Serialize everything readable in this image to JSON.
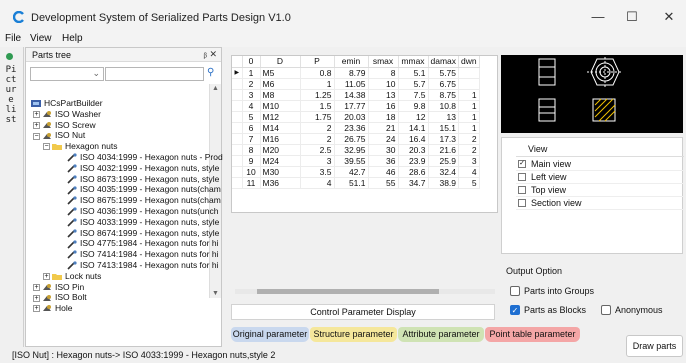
{
  "window": {
    "title": "Development System of Serialized Parts Design V1.0",
    "minimize": "—",
    "maximize": "☐",
    "close": "✕"
  },
  "menu": [
    "File",
    "View",
    "Help"
  ],
  "side_tab": {
    "label": "Picture list"
  },
  "tree_panel": {
    "title": "Parts tree",
    "header_buttons": "ᵦ ✕",
    "search_value": "",
    "items": [
      {
        "text": "HCsPartBuilder",
        "level": 0,
        "expander": "",
        "icon": "root"
      },
      {
        "text": "ISO Washer",
        "level": 1,
        "expander": "+",
        "icon": "part"
      },
      {
        "text": "ISO Screw",
        "level": 1,
        "expander": "+",
        "icon": "part"
      },
      {
        "text": "ISO Nut",
        "level": 1,
        "expander": "−",
        "icon": "part"
      },
      {
        "text": "Hexagon nuts",
        "level": 2,
        "expander": "−",
        "icon": "folder"
      },
      {
        "text": "ISO 4034:1999 - Hexagon nuts - Prod",
        "level": 3,
        "expander": "",
        "icon": "tool"
      },
      {
        "text": "ISO 4032:1999 - Hexagon nuts, style",
        "level": 3,
        "expander": "",
        "icon": "tool"
      },
      {
        "text": "ISO 8673:1999 - Hexagon nuts, style",
        "level": 3,
        "expander": "",
        "icon": "tool"
      },
      {
        "text": "ISO 4035:1999 - Hexagon nuts(cham",
        "level": 3,
        "expander": "",
        "icon": "tool"
      },
      {
        "text": "ISO 8675:1999 - Hexagon nuts(cham",
        "level": 3,
        "expander": "",
        "icon": "tool"
      },
      {
        "text": "ISO 4036:1999 - Hexagon nuts(unch",
        "level": 3,
        "expander": "",
        "icon": "tool"
      },
      {
        "text": "ISO 4033:1999 - Hexagon nuts, style",
        "level": 3,
        "expander": "",
        "icon": "tool"
      },
      {
        "text": "ISO 8674:1999 - Hexagon nuts, style",
        "level": 3,
        "expander": "",
        "icon": "tool"
      },
      {
        "text": "ISO 4775:1984 - Hexagon nuts for hi",
        "level": 3,
        "expander": "",
        "icon": "tool"
      },
      {
        "text": "ISO 7414:1984 - Hexagon nuts for hi",
        "level": 3,
        "expander": "",
        "icon": "tool"
      },
      {
        "text": "ISO 7413:1984 - Hexagon nuts for hi",
        "level": 3,
        "expander": "",
        "icon": "tool"
      },
      {
        "text": "Lock nuts",
        "level": 2,
        "expander": "+",
        "icon": "folder"
      },
      {
        "text": "ISO Pin",
        "level": 1,
        "expander": "+",
        "icon": "part"
      },
      {
        "text": "ISO Bolt",
        "level": 1,
        "expander": "+",
        "icon": "part"
      },
      {
        "text": "Hole",
        "level": 1,
        "expander": "+",
        "icon": "part"
      }
    ]
  },
  "grid": {
    "columns": [
      "",
      "0",
      "D",
      "P",
      "emin",
      "smax",
      "mmax",
      "damax",
      "dwn"
    ],
    "rows": [
      [
        "▶",
        "1",
        "M5",
        "0.8",
        "8.79",
        "8",
        "5.1",
        "5.75",
        ""
      ],
      [
        "",
        "2",
        "M6",
        "1",
        "11.05",
        "10",
        "5.7",
        "6.75",
        ""
      ],
      [
        "",
        "3",
        "M8",
        "1.25",
        "14.38",
        "13",
        "7.5",
        "8.75",
        "1"
      ],
      [
        "",
        "4",
        "M10",
        "1.5",
        "17.77",
        "16",
        "9.8",
        "10.8",
        "1"
      ],
      [
        "",
        "5",
        "M12",
        "1.75",
        "20.03",
        "18",
        "12",
        "13",
        "1"
      ],
      [
        "",
        "6",
        "M14",
        "2",
        "23.36",
        "21",
        "14.1",
        "15.1",
        "1"
      ],
      [
        "",
        "7",
        "M16",
        "2",
        "26.75",
        "24",
        "16.4",
        "17.3",
        "2"
      ],
      [
        "",
        "8",
        "M20",
        "2.5",
        "32.95",
        "30",
        "20.3",
        "21.6",
        "2"
      ],
      [
        "",
        "9",
        "M24",
        "3",
        "39.55",
        "36",
        "23.9",
        "25.9",
        "3"
      ],
      [
        "",
        "10",
        "M30",
        "3.5",
        "42.7",
        "46",
        "28.6",
        "32.4",
        "4"
      ],
      [
        "",
        "11",
        "M36",
        "4",
        "51.1",
        "55",
        "34.7",
        "38.9",
        "5"
      ]
    ]
  },
  "control_button": "Control Parameter Display",
  "tabs": [
    {
      "label": "Original parameter",
      "color": "#c9d8ee"
    },
    {
      "label": "Structure parameter",
      "color": "#f5e79b"
    },
    {
      "label": "Attribute parameter",
      "color": "#cfe3b4"
    },
    {
      "label": "Point table parameter",
      "color": "#f4a6a6"
    }
  ],
  "view_panel": {
    "header": "View",
    "items": [
      {
        "label": "Main view",
        "checked": true
      },
      {
        "label": "Left view",
        "checked": false
      },
      {
        "label": "Top view",
        "checked": false
      },
      {
        "label": "Section view",
        "checked": false
      }
    ]
  },
  "output_option": {
    "label": "Output Option",
    "parts_into_groups": {
      "label": "Parts into Groups",
      "checked": false
    },
    "parts_as_blocks": {
      "label": "Parts as Blocks",
      "checked": true
    },
    "anonymous": {
      "label": "Anonymous",
      "checked": false
    }
  },
  "draw_button": "Draw parts",
  "status": "[ISO Nut] : Hexagon nuts-> ISO 4033:1999 - Hexagon nuts,style 2",
  "colors": {
    "accent": "#1f6fd1",
    "preview_bg": "#000000",
    "preview_line": "#ffffff",
    "preview_highlight": "#f2c200"
  }
}
